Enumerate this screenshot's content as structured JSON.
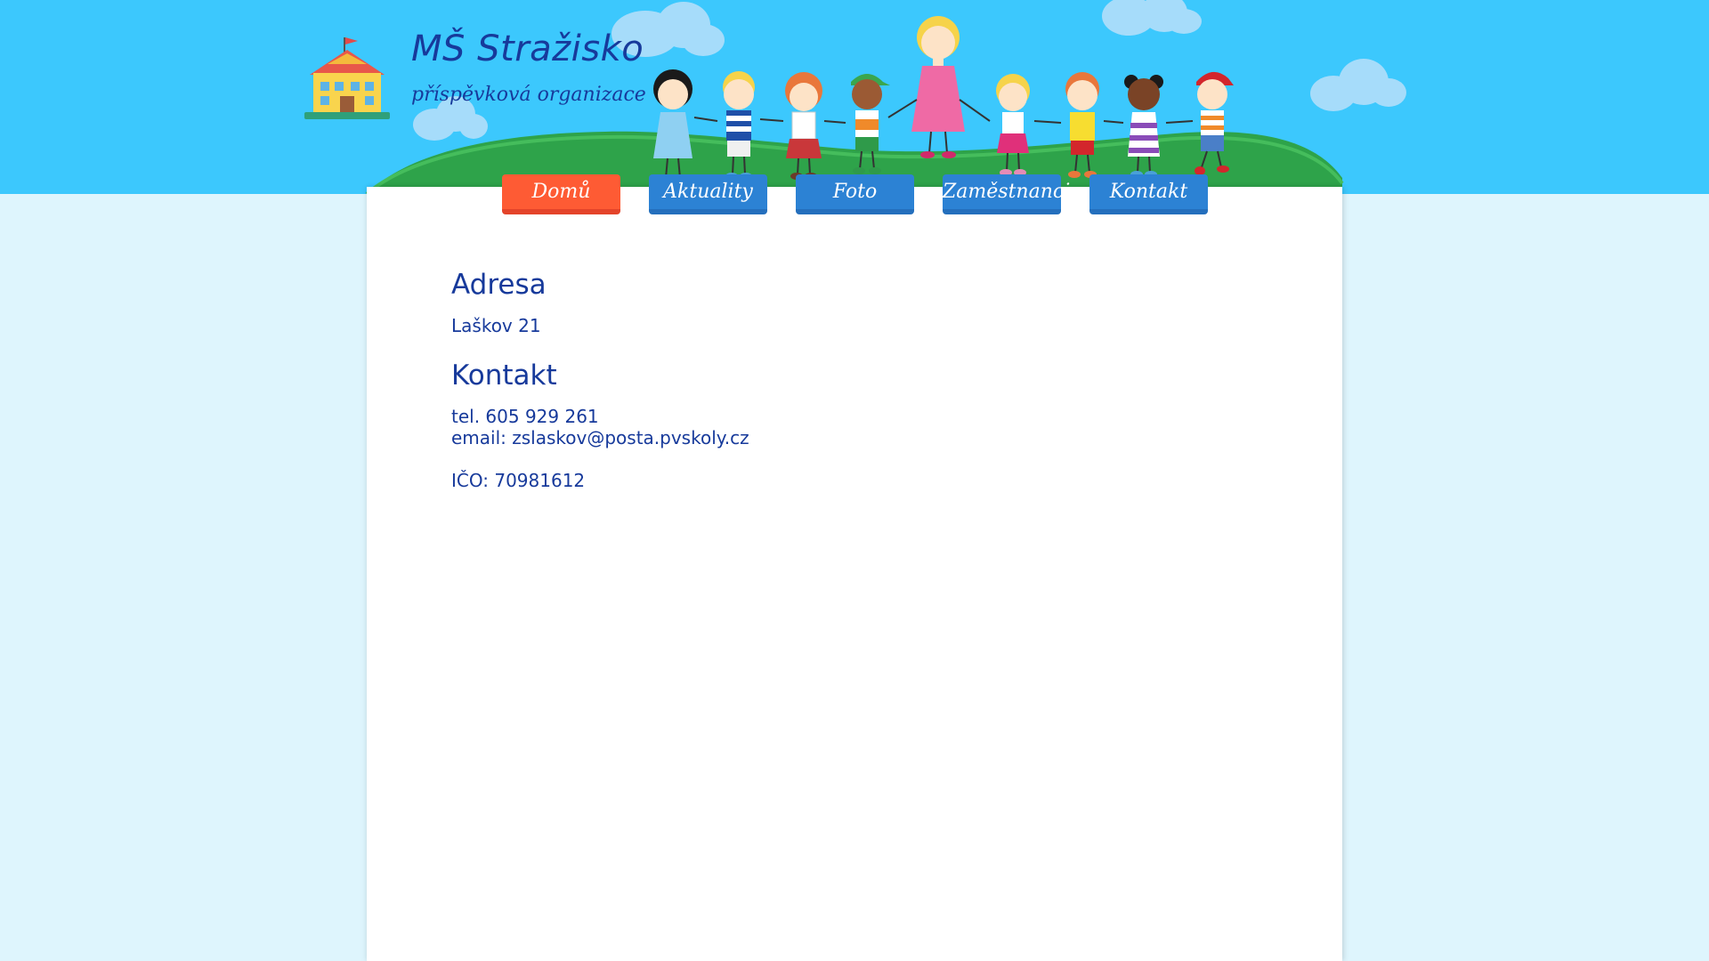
{
  "header": {
    "title": "MŠ Stražisko",
    "subtitle": "příspěvková organizace"
  },
  "nav": {
    "items": [
      {
        "label": "Domů",
        "active": true
      },
      {
        "label": "Aktuality",
        "active": false
      },
      {
        "label": "Foto",
        "active": false
      },
      {
        "label": "Zaměstnanci",
        "active": false
      },
      {
        "label": "Kontakt",
        "active": false
      }
    ]
  },
  "content": {
    "address_heading": "Adresa",
    "address": "Laškov 21",
    "contact_heading": "Kontakt",
    "phone": "tel. 605 929 261",
    "email": "email: zslaskov@posta.pvskoly.cz",
    "ico": "IČO: 70981612"
  },
  "colors": {
    "sky": "#3cc8fd",
    "background": "#def5fd",
    "text": "#173a9b",
    "nav_blue": "#2c82d4",
    "nav_active": "#fe5b34",
    "hill": "#2ea34a"
  },
  "icons": [
    "school-logo-icon",
    "cloud-icon",
    "children-illustration"
  ]
}
